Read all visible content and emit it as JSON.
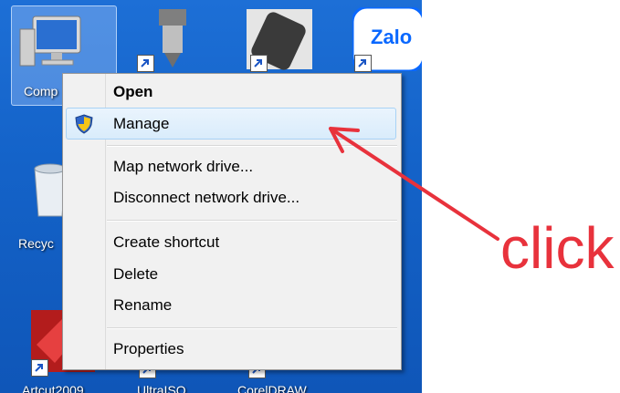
{
  "desktop": {
    "icons": [
      {
        "label": "Comp",
        "name": "computer"
      },
      {
        "label": "Recyc",
        "name": "recycle-bin"
      },
      {
        "label": "Artcut2009",
        "name": "artcut"
      },
      {
        "label": "UltraISO",
        "name": "ultraiso"
      },
      {
        "label": "CorelDRAW",
        "name": "coreldraw"
      }
    ],
    "zalo_label": "Zalo"
  },
  "menu": {
    "items": [
      {
        "label": "Open"
      },
      {
        "label": "Manage"
      },
      {
        "label": "Map network drive..."
      },
      {
        "label": "Disconnect network drive..."
      },
      {
        "label": "Create shortcut"
      },
      {
        "label": "Delete"
      },
      {
        "label": "Rename"
      },
      {
        "label": "Properties"
      }
    ]
  },
  "annotation": {
    "text": "click",
    "color": "#e8323c"
  }
}
